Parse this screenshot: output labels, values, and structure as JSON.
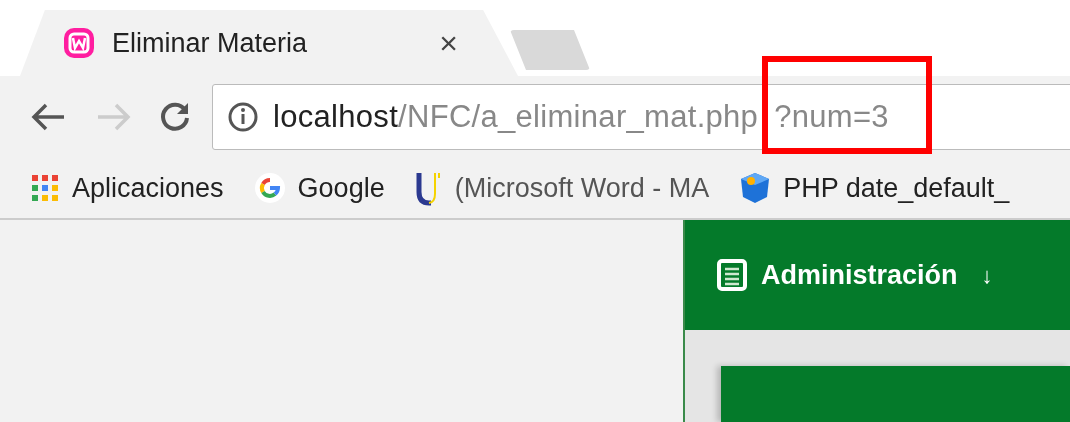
{
  "tabs": [
    {
      "kind": "page",
      "title": "Eliminar Materia",
      "close": "×",
      "selected": true
    },
    {
      "kind": "new",
      "selected": false
    }
  ],
  "toolbar": {
    "forward_disabled": true
  },
  "address": {
    "host": "localhost",
    "path": "/NFC/a_eliminar_mat.php",
    "query": "?num=3",
    "highlighted": true
  },
  "bookmarks": [
    {
      "kind": "apps",
      "label": "Aplicaciones",
      "faded": false
    },
    {
      "kind": "google",
      "label": "Google",
      "faded": false
    },
    {
      "kind": "u",
      "label": "(Microsoft Word - MA",
      "faded": true
    },
    {
      "kind": "php",
      "label": "PHP date_default_",
      "faded": false
    }
  ],
  "nav": {
    "label": "Administración",
    "arrow": "↓"
  }
}
